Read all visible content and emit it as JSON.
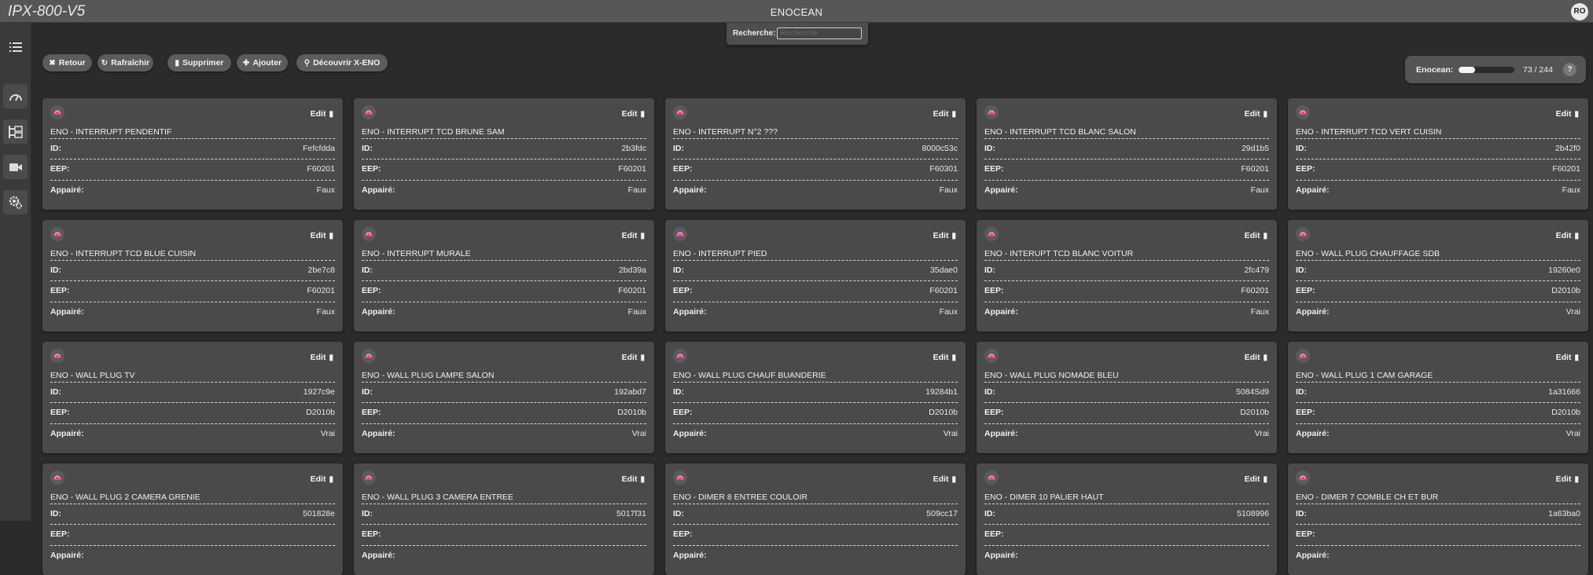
{
  "header": {
    "brand": "IPX-800-V5",
    "title": "ENOCEAN",
    "user_initials": "RO"
  },
  "search": {
    "label": "Recherche:",
    "placeholder": "Recherche",
    "value": ""
  },
  "toolbar": {
    "back": {
      "label": "Retour",
      "icon": "x-icon"
    },
    "refresh": {
      "label": "Rafraîchir",
      "icon": "refresh-icon"
    },
    "delete": {
      "label": "Supprimer",
      "icon": "trash-icon"
    },
    "add": {
      "label": "Ajouter",
      "icon": "plus-icon"
    },
    "discover": {
      "label": "Découvrir X-ENO",
      "icon": "search-icon"
    }
  },
  "counter": {
    "label": "Enocean:",
    "text": "73 / 244",
    "used": 73,
    "total": 244,
    "help": "?"
  },
  "sidebar": {
    "items": [
      "list-icon",
      "dashboard-icon",
      "tree-icon",
      "camera-icon",
      "settings-icon"
    ]
  },
  "fields": {
    "id": "ID:",
    "eep": "EEP:",
    "paired": "Appairé:",
    "edit": "Edit"
  },
  "colors": {
    "accent": "#e8458b",
    "card": "#4a4a4a",
    "background": "#2b2b2b"
  },
  "devices": [
    {
      "name": "ENO - INTERRUPT PENDENTIF",
      "id": "Fefcfdda",
      "eep": "F60201",
      "paired": "Faux"
    },
    {
      "name": "ENO - INTERRUPT TCD BRUNE SAM",
      "id": "2b3fdc",
      "eep": "F60201",
      "paired": "Faux"
    },
    {
      "name": "ENO - INTERRUPT N°2 ???",
      "id": "8000c53c",
      "eep": "F60301",
      "paired": "Faux"
    },
    {
      "name": "ENO - INTERRUPT TCD BLANC SALON",
      "id": "29d1b5",
      "eep": "F60201",
      "paired": "Faux"
    },
    {
      "name": "ENO - INTERRUPT TCD VERT CUISIN",
      "id": "2b42f0",
      "eep": "F60201",
      "paired": "Faux"
    },
    {
      "name": "ENO - INTERRUPT TCD BLUE CUISIN",
      "id": "2be7c8",
      "eep": "F60201",
      "paired": "Faux"
    },
    {
      "name": "ENO - INTERRUPT MURALE",
      "id": "2bd39a",
      "eep": "F60201",
      "paired": "Faux"
    },
    {
      "name": "ENO - INTERRUPT PIED",
      "id": "35dae0",
      "eep": "F60201",
      "paired": "Faux"
    },
    {
      "name": "ENO - INTERUPT TCD BLANC VOITUR",
      "id": "2fc479",
      "eep": "F60201",
      "paired": "Faux"
    },
    {
      "name": "ENO - WALL PLUG CHAUFFAGE SDB",
      "id": "19260e0",
      "eep": "D2010b",
      "paired": "Vrai"
    },
    {
      "name": "ENO - WALL PLUG TV",
      "id": "1927c9e",
      "eep": "D2010b",
      "paired": "Vrai"
    },
    {
      "name": "ENO - WALL PLUG LAMPE SALON",
      "id": "192abd7",
      "eep": "D2010b",
      "paired": "Vrai"
    },
    {
      "name": "ENO - WALL PLUG CHAUF BUANDERIE",
      "id": "19284b1",
      "eep": "D2010b",
      "paired": "Vrai"
    },
    {
      "name": "ENO - WALL PLUG NOMADE BLEU",
      "id": "5084Sd9",
      "eep": "D2010b",
      "paired": "Vrai"
    },
    {
      "name": "ENO - WALL PLUG 1 CAM GARAGE",
      "id": "1a31666",
      "eep": "D2010b",
      "paired": "Vrai"
    },
    {
      "name": "ENO - WALL PLUG 2 CAMERA GRENIE",
      "id": "501828e",
      "eep": "",
      "paired": ""
    },
    {
      "name": "ENO - WALL PLUG 3 CAMERA ENTREE",
      "id": "5017f31",
      "eep": "",
      "paired": ""
    },
    {
      "name": "ENO - DIMER 8 ENTREE COULOIR",
      "id": "509cc17",
      "eep": "",
      "paired": ""
    },
    {
      "name": "ENO - DIMER 10 PALIER HAUT",
      "id": "5108996",
      "eep": "",
      "paired": ""
    },
    {
      "name": "ENO - DIMER 7 COMBLE CH ET BUR",
      "id": "1a63ba0",
      "eep": "",
      "paired": ""
    }
  ]
}
